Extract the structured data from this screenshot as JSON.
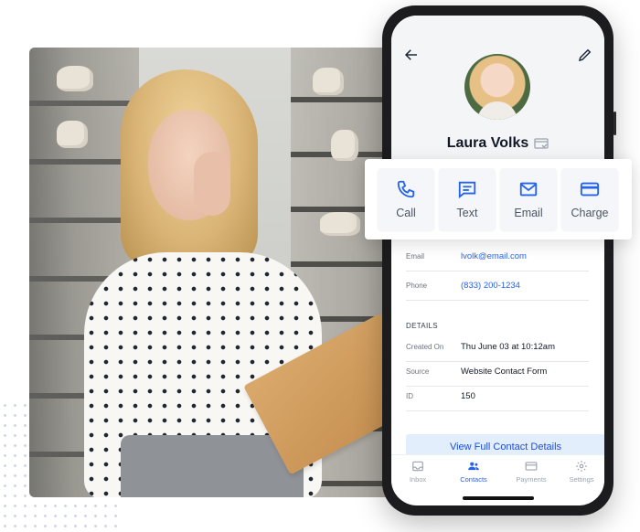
{
  "contact": {
    "name": "Laura Volks"
  },
  "actions": [
    {
      "label": "Call",
      "icon": "phone-icon"
    },
    {
      "label": "Text",
      "icon": "message-icon"
    },
    {
      "label": "Email",
      "icon": "envelope-icon"
    },
    {
      "label": "Charge",
      "icon": "credit-card-icon"
    }
  ],
  "fields": {
    "email_label": "Email",
    "email_value": "lvolk@email.com",
    "phone_label": "Phone",
    "phone_value": "(833) 200-1234"
  },
  "details": {
    "section_title": "DETAILS",
    "created_label": "Created On",
    "created_value": "Thu June 03 at 10:12am",
    "source_label": "Source",
    "source_value": "Website Contact Form",
    "id_label": "ID",
    "id_value": "150"
  },
  "cta_label": "View Full Contact Details",
  "tabs": [
    {
      "label": "Inbox",
      "icon": "inbox-icon",
      "active": false
    },
    {
      "label": "Contacts",
      "icon": "contacts-icon",
      "active": true
    },
    {
      "label": "Payments",
      "icon": "payments-icon",
      "active": false
    },
    {
      "label": "Settings",
      "icon": "gear-icon",
      "active": false
    }
  ],
  "colors": {
    "accent": "#2563eb",
    "cta_bg": "#e3eefc",
    "phone_frame": "#1c1c1e"
  }
}
